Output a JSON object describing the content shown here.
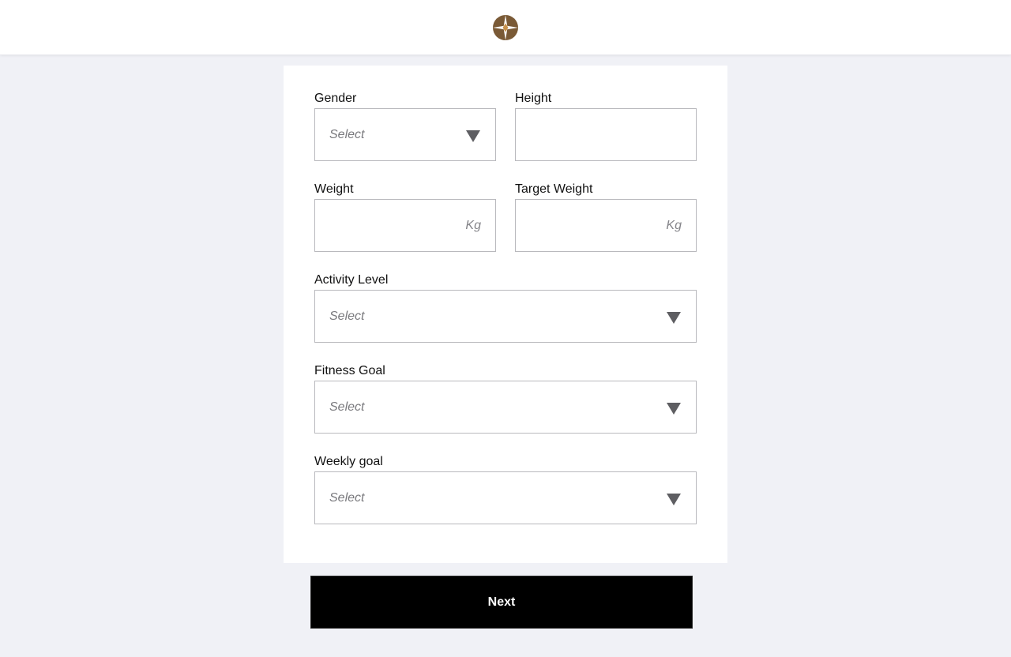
{
  "header": {
    "logo": "compass-star-logo",
    "logo_color": "#7a5a36"
  },
  "form": {
    "gender": {
      "label": "Gender",
      "placeholder": "Select"
    },
    "height": {
      "label": "Height",
      "value": ""
    },
    "weight": {
      "label": "Weight",
      "unit": "Kg",
      "value": ""
    },
    "target_weight": {
      "label": "Target Weight",
      "unit": "Kg",
      "value": ""
    },
    "activity_level": {
      "label": "Activity Level",
      "placeholder": "Select"
    },
    "fitness_goal": {
      "label": "Fitness Goal",
      "placeholder": "Select"
    },
    "weekly_goal": {
      "label": "Weekly goal",
      "placeholder": "Select"
    }
  },
  "actions": {
    "next_label": "Next"
  },
  "colors": {
    "background": "#f0f1f6",
    "card": "#ffffff",
    "button": "#000000",
    "border": "#b9b9bd"
  }
}
